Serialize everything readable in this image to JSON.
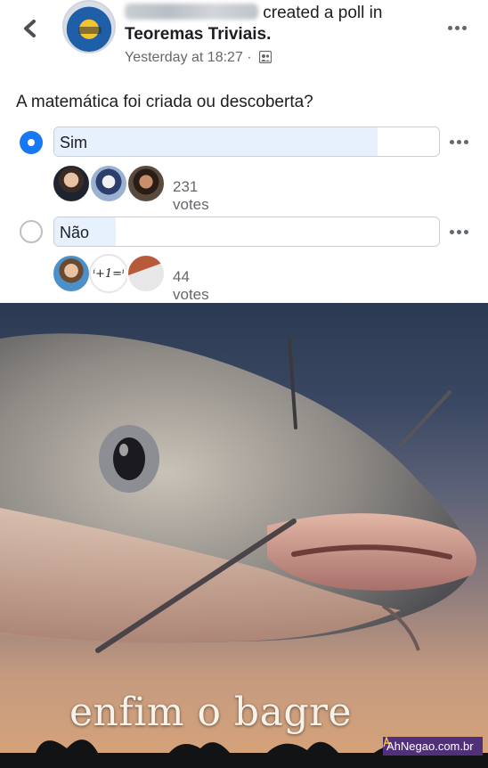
{
  "post": {
    "author_suffix": "created a poll in",
    "group": "Teoremas Triviais.",
    "time": "Yesterday at 18:27 ·",
    "question": "A matemática foi criada ou descoberta?",
    "icons": {
      "back": "chevron-left-icon",
      "privacy": "group-members-icon",
      "more": "more-horizontal-icon"
    }
  },
  "poll": {
    "options": [
      {
        "label": "Sim",
        "votes": "231 votes",
        "selected": true,
        "fill_fraction": 0.84
      },
      {
        "label": "Não",
        "votes": "44 votes",
        "selected": false,
        "fill_fraction": 0.16
      }
    ],
    "accent_color": "#1877f2"
  },
  "meme": {
    "caption": "enfim o bagre",
    "watermark": "AhNegao.com.br",
    "watermark_color": "#51307a"
  }
}
